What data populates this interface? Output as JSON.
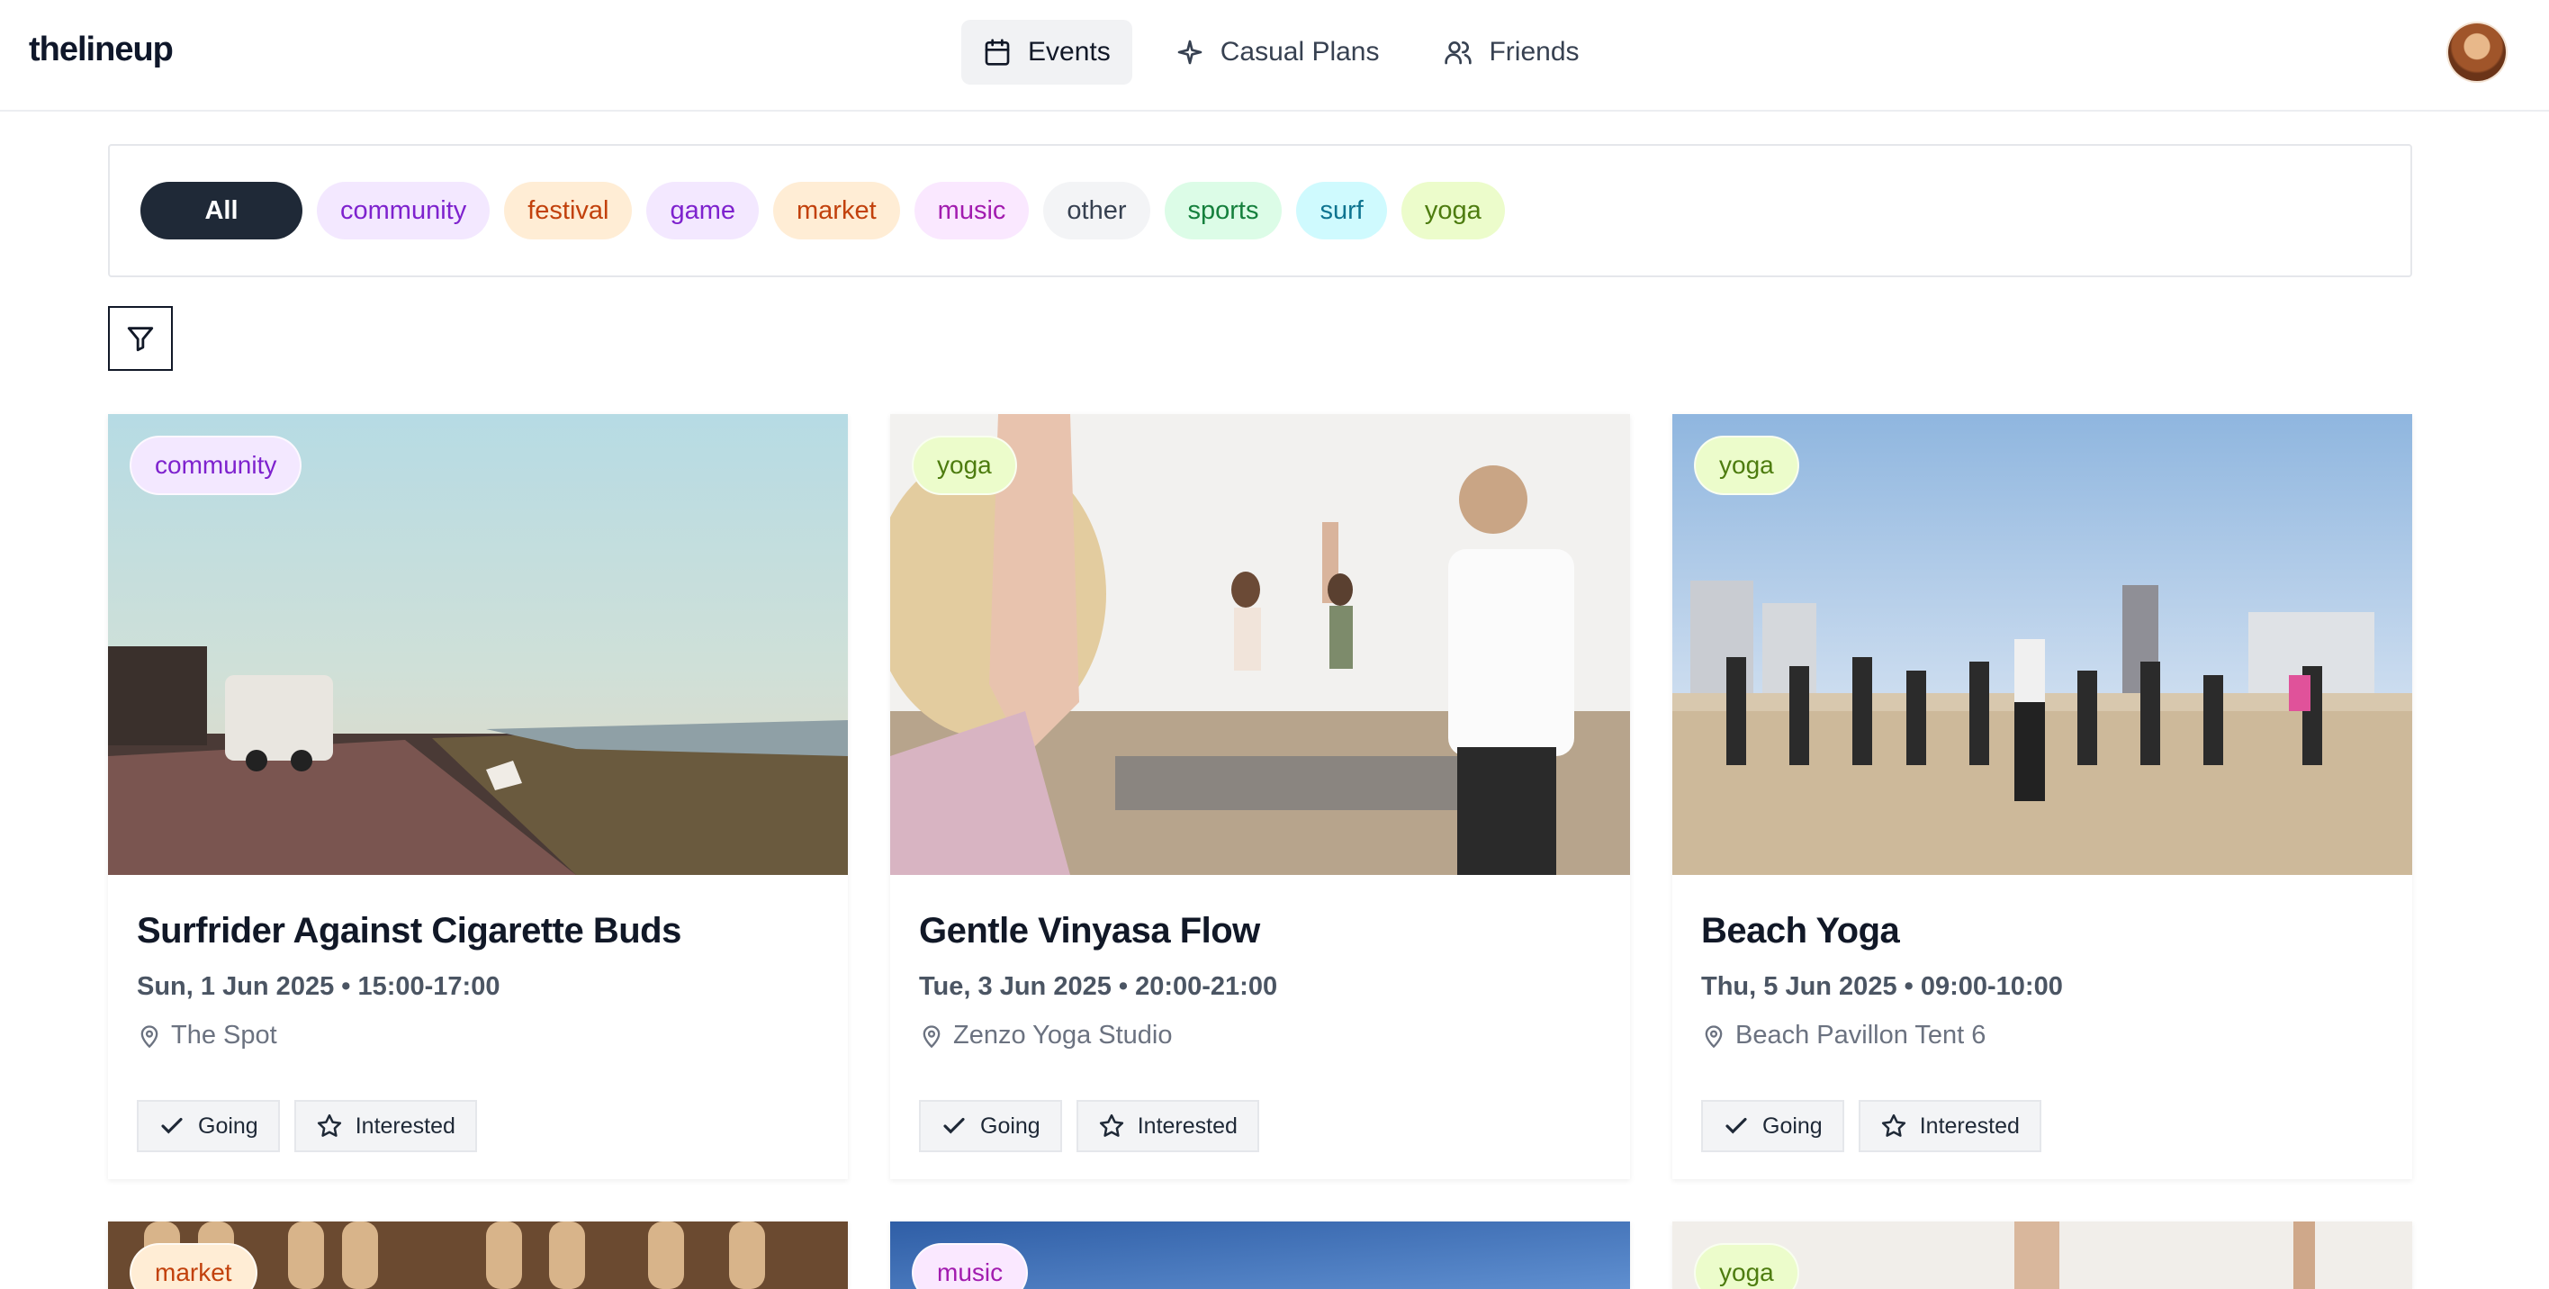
{
  "brand": "thelineup",
  "nav": {
    "events": "Events",
    "casual_plans": "Casual Plans",
    "friends": "Friends"
  },
  "categories": [
    {
      "label": "All",
      "bg": "#1f2937",
      "fg": "#ffffff"
    },
    {
      "label": "community",
      "bg": "#f3e8ff",
      "fg": "#7e22ce"
    },
    {
      "label": "festival",
      "bg": "#ffedd5",
      "fg": "#c2410c"
    },
    {
      "label": "game",
      "bg": "#f3e8ff",
      "fg": "#7e22ce"
    },
    {
      "label": "market",
      "bg": "#ffedd5",
      "fg": "#c2410c"
    },
    {
      "label": "music",
      "bg": "#fae8ff",
      "fg": "#a21caf"
    },
    {
      "label": "other",
      "bg": "#f3f4f6",
      "fg": "#374151"
    },
    {
      "label": "sports",
      "bg": "#dcfce7",
      "fg": "#15803d"
    },
    {
      "label": "surf",
      "bg": "#cffafe",
      "fg": "#0e7490"
    },
    {
      "label": "yoga",
      "bg": "#ecfccb",
      "fg": "#4d7c0f"
    }
  ],
  "actions": {
    "going": "Going",
    "interested": "Interested"
  },
  "events": [
    {
      "tag": "community",
      "title": "Surfrider Against Cigarette Buds",
      "when": "Sun, 1 Jun 2025 • 15:00-17:00",
      "where": "The Spot"
    },
    {
      "tag": "yoga",
      "title": "Gentle Vinyasa Flow",
      "when": "Tue, 3 Jun 2025 • 20:00-21:00",
      "where": "Zenzo Yoga Studio"
    },
    {
      "tag": "yoga",
      "title": "Beach Yoga",
      "when": "Thu, 5 Jun 2025 • 09:00-10:00",
      "where": "Beach Pavillon Tent 6"
    }
  ],
  "next_row_tags": [
    "market",
    "music",
    "yoga"
  ]
}
